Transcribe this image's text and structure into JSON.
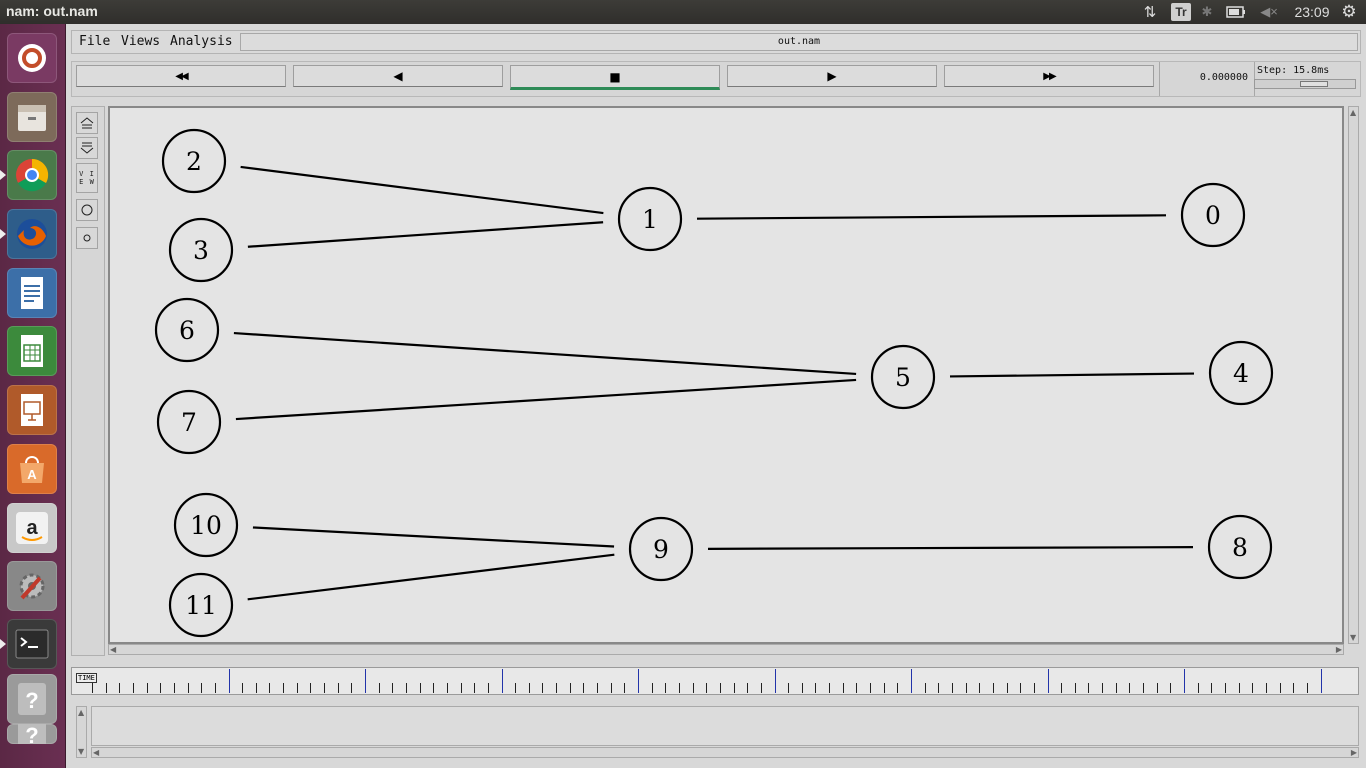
{
  "topbar": {
    "title": "nam: out.nam",
    "keyboard_indicator": "Tr",
    "clock": "23:09"
  },
  "launcher": {
    "items": [
      {
        "name": "ubuntu-dash-icon",
        "bg": "#7a3a63"
      },
      {
        "name": "files-icon",
        "bg": "#7d6a5a"
      },
      {
        "name": "chrome-icon",
        "bg": "#4a7a4a"
      },
      {
        "name": "firefox-icon",
        "bg": "#2e5d8a"
      },
      {
        "name": "libreoffice-writer-icon",
        "bg": "#3c6fa8"
      },
      {
        "name": "libreoffice-calc-icon",
        "bg": "#3c8a3c"
      },
      {
        "name": "libreoffice-impress-icon",
        "bg": "#b05a2a"
      },
      {
        "name": "software-center-icon",
        "bg": "#d96a2a"
      },
      {
        "name": "amazon-icon",
        "bg": "#c8c8c8"
      },
      {
        "name": "system-settings-icon",
        "bg": "#888888"
      },
      {
        "name": "terminal-icon",
        "bg": "#3a3a3a"
      },
      {
        "name": "help-icon",
        "bg": "#9a9a9a"
      },
      {
        "name": "help-icon-2",
        "bg": "#9a9a9a"
      }
    ]
  },
  "menu": {
    "file": "File",
    "views": "Views",
    "analysis": "Analysis",
    "filename": "out.nam"
  },
  "controls": {
    "rewind": "◀◀",
    "back": "◀",
    "stop": "■",
    "play": "▶",
    "fast_forward": "▶▶",
    "time": "0.000000",
    "step": "Step: 15.8ms",
    "step_level": 0.62
  },
  "tools": {
    "view": "V I E W"
  },
  "timeline": {
    "tag": "TIME"
  },
  "topology": {
    "nodes": [
      {
        "id": "0"
      },
      {
        "id": "1"
      },
      {
        "id": "2"
      },
      {
        "id": "3"
      },
      {
        "id": "4"
      },
      {
        "id": "5"
      },
      {
        "id": "6"
      },
      {
        "id": "7"
      },
      {
        "id": "8"
      },
      {
        "id": "9"
      },
      {
        "id": "10"
      },
      {
        "id": "11"
      }
    ],
    "links": [
      [
        "2",
        "1"
      ],
      [
        "3",
        "1"
      ],
      [
        "1",
        "0"
      ],
      [
        "6",
        "5"
      ],
      [
        "7",
        "5"
      ],
      [
        "5",
        "4"
      ],
      [
        "10",
        "9"
      ],
      [
        "11",
        "9"
      ],
      [
        "9",
        "8"
      ]
    ]
  },
  "colors": {
    "stop_accent": "#2e8b57",
    "launcher_bg": "#5b2845"
  }
}
